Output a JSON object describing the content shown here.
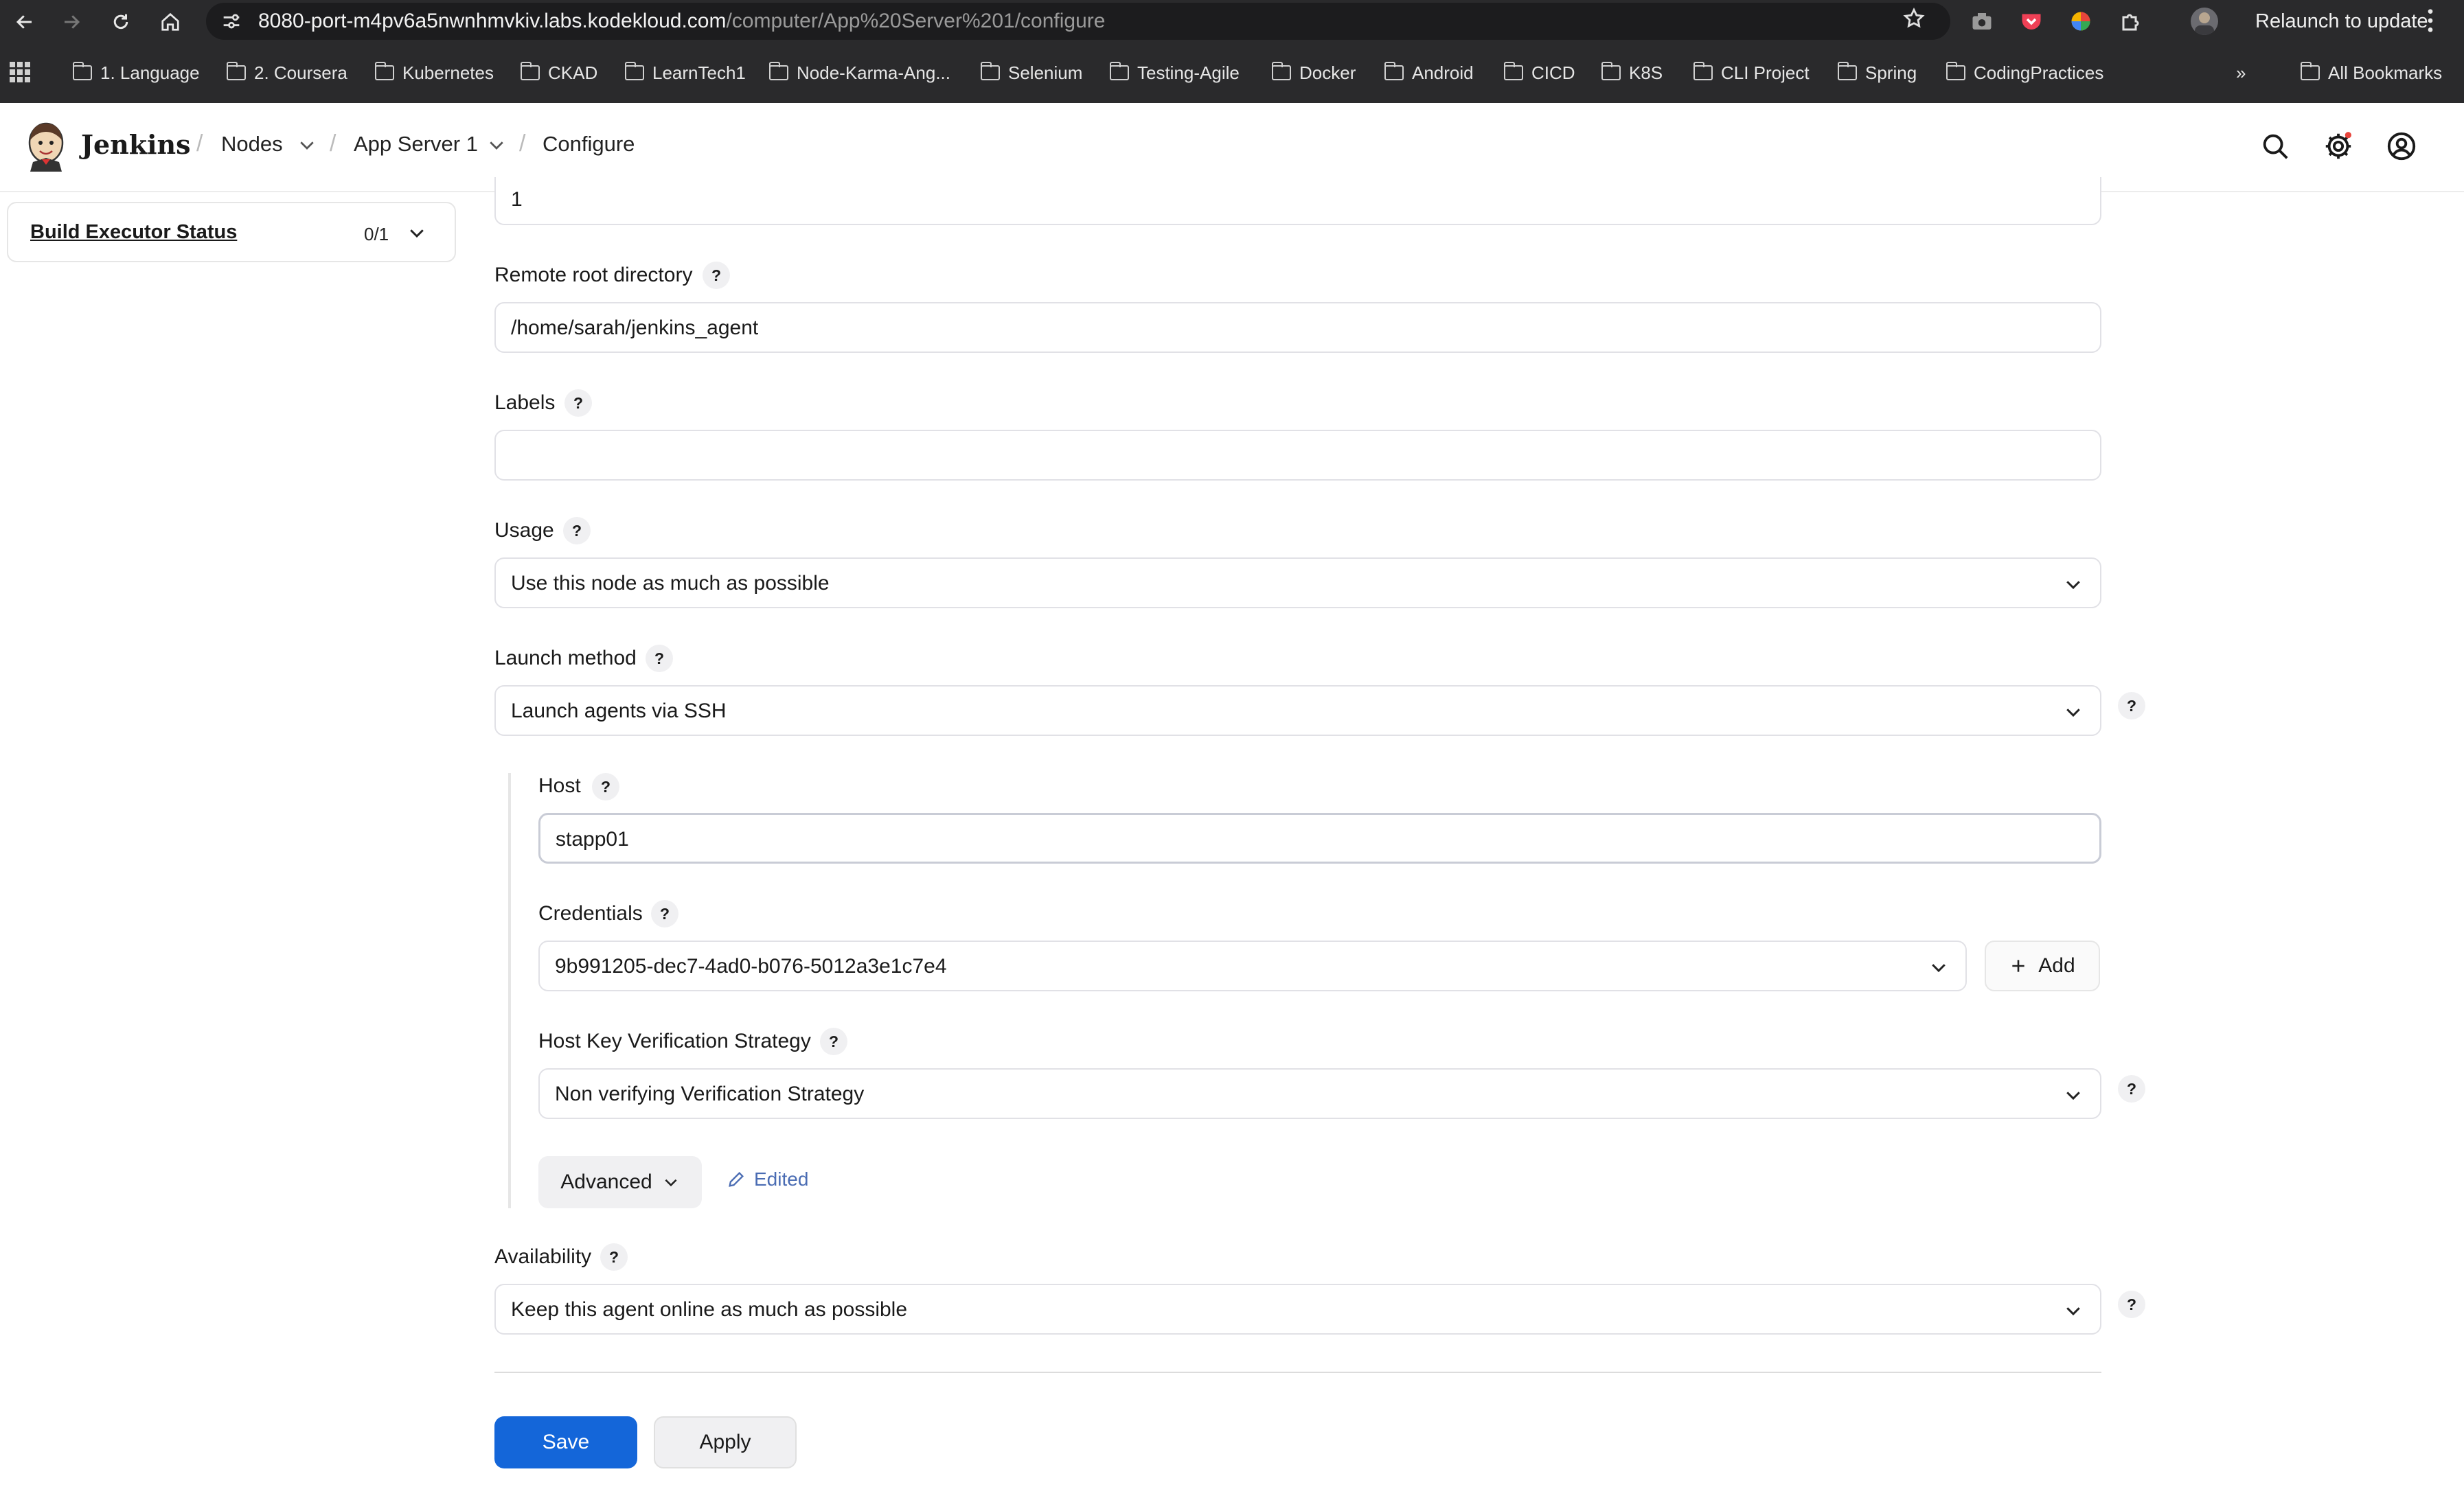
{
  "browser": {
    "url_host": "8080-port-m4pv6a5nwnhmvkiv.labs.kodekloud.com",
    "url_path": "/computer/App%20Server%201/configure",
    "relaunch_label": "Relaunch to update",
    "bookmarks": [
      "1. Language",
      "2. Coursera",
      "Kubernetes",
      "CKAD",
      "LearnTech1",
      "Node-Karma-Ang...",
      "Selenium",
      "Testing-Agile",
      "Docker",
      "Android",
      "CICD",
      "K8S",
      "CLI Project",
      "Spring",
      "CodingPractices"
    ],
    "all_bookmarks_label": "All Bookmarks",
    "more_label": "»"
  },
  "header": {
    "app_title": "Jenkins",
    "breadcrumbs": [
      "Nodes",
      "App Server 1",
      "Configure"
    ],
    "separator": "/"
  },
  "sidebar": {
    "build_executor_status_label": "Build Executor Status",
    "build_executor_count": "0/1"
  },
  "form": {
    "executors_value": "1",
    "remote_root": {
      "label": "Remote root directory",
      "value": "/home/sarah/jenkins_agent"
    },
    "labels": {
      "label": "Labels",
      "value": ""
    },
    "usage": {
      "label": "Usage",
      "value": "Use this node as much as possible"
    },
    "launch_method": {
      "label": "Launch method",
      "value": "Launch agents via SSH"
    },
    "host": {
      "label": "Host",
      "value": "stapp01"
    },
    "credentials": {
      "label": "Credentials",
      "value": "9b991205-dec7-4ad0-b076-5012a3e1c7e4",
      "add_label": "Add"
    },
    "host_key": {
      "label": "Host Key Verification Strategy",
      "value": "Non verifying Verification Strategy"
    },
    "advanced_label": "Advanced",
    "edited_label": "Edited",
    "availability": {
      "label": "Availability",
      "value": "Keep this agent online as much as possible"
    },
    "help_glyph": "?"
  },
  "actions": {
    "save_label": "Save",
    "apply_label": "Apply"
  },
  "colors": {
    "primary": "#1466d9",
    "edited": "#4a6cb3",
    "chrome": "#2a2a2c"
  }
}
